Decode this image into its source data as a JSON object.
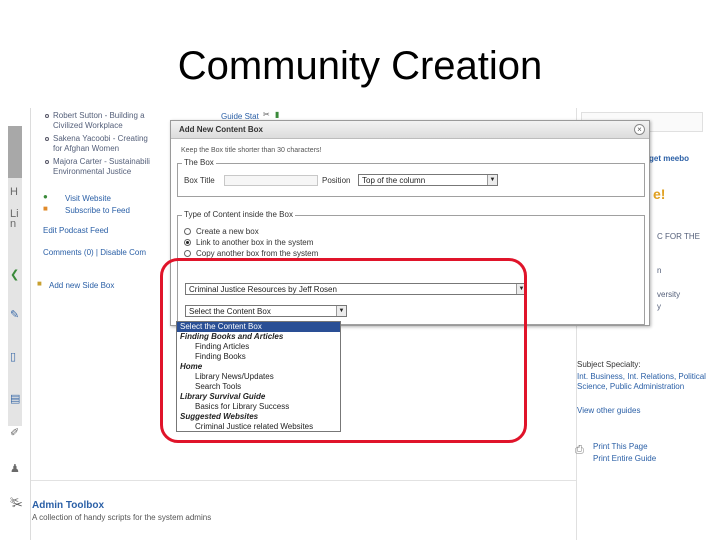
{
  "slide": {
    "title": "Community Creation"
  },
  "background": {
    "bullets": [
      "Robert Sutton - Building a",
      "Civilized Workplace",
      "Sakena Yacoobi - Creating",
      "for Afghan Women",
      "Majora Carter - Sustainabili",
      "Environmental Justice"
    ],
    "visit_website": "Visit Website",
    "subscribe_feed": "Subscribe to Feed",
    "edit_podcast_feed": "Edit Podcast Feed",
    "comments": "Comments (0) | Disable Com",
    "add_side_box": "Add new Side Box",
    "guide_stats": "Guide Stat",
    "admin_toolbox_title": "Admin Toolbox",
    "admin_toolbox_desc": "A collection of handy scripts for the system admins",
    "left_letters": [
      "H",
      "Li",
      "n"
    ],
    "right": {
      "meebo": "get meebo",
      "for_the": "C FOR THE",
      "n_line": "n",
      "versity": "versity",
      "y_line": "y",
      "subject_specialty": "Subject Specialty:",
      "subject_line1": "Int. Business, Int. Relations, Political",
      "subject_line2": "Science, Public Administration",
      "view_other_guides": "View other guides",
      "print_page": "Print This Page",
      "print_guide": "Print Entire Guide"
    }
  },
  "dialog": {
    "title": "Add New Content Box",
    "hint": "Keep the Box title shorter than 30 characters!",
    "box_section_legend": "The Box",
    "box_title_label": "Box Title",
    "box_title_value": "",
    "position_label": "Position",
    "position_value": "Top of the column",
    "type_section_legend": "Type of Content inside the Box",
    "radio_options": [
      {
        "label": "Create a new box",
        "checked": false
      },
      {
        "label": "Link to another box in the system",
        "checked": true
      },
      {
        "label": "Copy another box from the system",
        "checked": false
      }
    ],
    "guide_select_value": "Criminal Justice Resources by Jeff Rosen",
    "content_select_value": "Select the Content Box",
    "content_options": [
      {
        "label": "Select the Content Box",
        "kind": "selected"
      },
      {
        "label": "Finding Books and Articles",
        "kind": "group"
      },
      {
        "label": "Finding Articles",
        "kind": "item"
      },
      {
        "label": "Finding Books",
        "kind": "item"
      },
      {
        "label": "Home",
        "kind": "group"
      },
      {
        "label": "Library News/Updates",
        "kind": "item"
      },
      {
        "label": "Search Tools",
        "kind": "item"
      },
      {
        "label": "Library Survival Guide",
        "kind": "group"
      },
      {
        "label": "Basics for Library Success",
        "kind": "item"
      },
      {
        "label": "Suggested Websites",
        "kind": "group"
      },
      {
        "label": "Criminal Justice related Websites",
        "kind": "item"
      }
    ]
  },
  "colors": {
    "highlight": "#e0142a",
    "selection": "#2a4f95",
    "link": "#2a5fa6"
  },
  "icons": {
    "close": "close-icon",
    "dropdown": "chevron-down-icon",
    "rss": "rss-icon",
    "globe": "globe-icon",
    "printer": "printer-icon",
    "tools": "tools-icon"
  }
}
